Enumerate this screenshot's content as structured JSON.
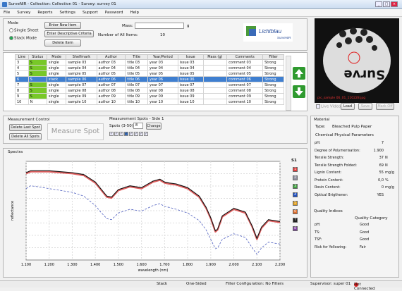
{
  "window": {
    "title": "SurveNIR - Collection: Collection 01 - Survey: survey 01"
  },
  "menu": [
    "File",
    "Survey",
    "Reports",
    "Settings",
    "Support",
    "Password",
    "Help"
  ],
  "mode": {
    "label": "Mode",
    "options": [
      "Single Sheet",
      "Stack Mode"
    ],
    "selected": "Stack Mode"
  },
  "buttons": {
    "enter_new": "Enter New Item",
    "enter_desc": "Enter Descriptive Criteria",
    "delete_item": "Delete Item",
    "delete_last": "Delete Last Spot",
    "delete_all": "Delete All Spots",
    "measure": "Measure Spot",
    "change": "Change",
    "live": "Live Video",
    "load": "Load",
    "save": "Save",
    "mark_off": "Mark Off"
  },
  "mass": {
    "label": "Mass:",
    "unit": "g",
    "items_label": "Number of All Items:",
    "items_value": "10"
  },
  "logo": {
    "text": "Lichtblau",
    "sub": "SurveNIR"
  },
  "camera": {
    "overlay": "Surve",
    "caption": "pic_sample 06_01_110228.jpg"
  },
  "table": {
    "columns": [
      "Line",
      "Status",
      "Mode",
      "Shelfmark",
      "Author",
      "Title",
      "Year/Period",
      "Issue",
      "Mass (g)",
      "Comments",
      "Filter"
    ],
    "rows": [
      [
        "3",
        "S",
        "single",
        "sample 03",
        "author 03",
        "title 03",
        "year 03",
        "issue 03",
        "",
        "comment 03",
        "Strong"
      ],
      [
        "4",
        "S",
        "single",
        "sample 04",
        "author 04",
        "title 04",
        "year 04",
        "issue 04",
        "",
        "comment 04",
        "Strong"
      ],
      [
        "5",
        "S",
        "single",
        "sample 05",
        "author 05",
        "title 05",
        "year 05",
        "issue 05",
        "",
        "comment 05",
        "Strong"
      ],
      [
        "6",
        "S",
        "stack",
        "sample 06",
        "author 06",
        "title 06",
        "year 06",
        "issue 06",
        "",
        "comment 06",
        "Strong"
      ],
      [
        "7",
        "S",
        "single",
        "sample 07",
        "author 07",
        "title 07",
        "year 07",
        "issue 07",
        "",
        "comment 07",
        "Strong"
      ],
      [
        "8",
        "S",
        "single",
        "sample 08",
        "author 08",
        "title 08",
        "year 08",
        "issue 08",
        "",
        "comment 08",
        "Strong"
      ],
      [
        "9",
        "S",
        "single",
        "sample 09",
        "author 09",
        "title 09",
        "year 09",
        "issue 09",
        "",
        "comment 09",
        "Strong"
      ],
      [
        "10",
        "N",
        "single",
        "sample 10",
        "author 10",
        "title 10",
        "year 10",
        "issue 10",
        "",
        "comment 10",
        "Strong"
      ]
    ],
    "selected_row": 3
  },
  "measure": {
    "control_label": "Measurement Control",
    "spots_label": "Measurement Spots - Side 1",
    "spots_count_label": "Spots (3-50):",
    "spots_count": "8"
  },
  "spectra": {
    "label": "Spectra",
    "side": "S1",
    "swatches": [
      "1",
      "2",
      "3",
      "4",
      "5",
      "6",
      "7",
      "8"
    ],
    "swatch_colors": [
      "#e04040",
      "#9090a0",
      "#40a040",
      "#2050c0",
      "#e0a020",
      "#e07030",
      "#202020",
      "#8040a0"
    ]
  },
  "material": {
    "label": "Material",
    "type_label": "Type:",
    "type_value": "Bleached Pulp Paper",
    "chem_label": "Chemical Physical Parameters",
    "params": [
      [
        "pH:",
        "7",
        ""
      ],
      [
        "Degree of Polymerisation:",
        "1.900",
        ""
      ],
      [
        "Tensile Strength:",
        "37",
        "N"
      ],
      [
        "Tensile Strength Folded:",
        "69",
        "N"
      ],
      [
        "Lignin Content:",
        "55",
        "mg/g"
      ],
      [
        "Protein Content:",
        "0,0",
        "%"
      ],
      [
        "Rosin Content:",
        "0",
        "mg/g"
      ],
      [
        "Optical Brigthener:",
        "YES",
        ""
      ]
    ],
    "quality_label": "Quality Indices",
    "quality_cat": "Quality Category",
    "quality": [
      [
        "pH:",
        "Good"
      ],
      [
        "TS:",
        "Good"
      ],
      [
        "TSF:",
        "Good"
      ],
      [
        "Risk for Yellowing:",
        "Fair"
      ]
    ]
  },
  "status": {
    "stack": "Stack",
    "sided": "One-Sided",
    "filter": "Filter Configuration: No Filters",
    "supervisor": "Supervisor: super 01",
    "conn": "Not Connected"
  },
  "chart_data": {
    "type": "line",
    "xlabel": "wavelength (nm)",
    "ylabel": "reflectance",
    "xlim": [
      1100,
      2200
    ],
    "x_ticks": [
      "1.100",
      "1.200",
      "1.300",
      "1.400",
      "1.500",
      "1.600",
      "1.700",
      "1.800",
      "1.900",
      "2.000",
      "2.100",
      "2.200"
    ],
    "x": [
      1100,
      1120,
      1150,
      1200,
      1250,
      1300,
      1350,
      1400,
      1420,
      1450,
      1470,
      1500,
      1550,
      1600,
      1650,
      1680,
      1700,
      1720,
      1750,
      1800,
      1850,
      1880,
      1900,
      1920,
      1930,
      1950,
      2000,
      2050,
      2080,
      2100,
      2120,
      2150,
      2200
    ],
    "series": [
      {
        "values": [
          0.82,
          0.84,
          0.84,
          0.84,
          0.83,
          0.82,
          0.8,
          0.72,
          0.66,
          0.57,
          0.56,
          0.64,
          0.68,
          0.66,
          0.73,
          0.75,
          0.72,
          0.71,
          0.7,
          0.66,
          0.57,
          0.45,
          0.34,
          0.2,
          0.22,
          0.36,
          0.44,
          0.4,
          0.25,
          0.12,
          0.24,
          0.32,
          0.3
        ]
      },
      {
        "values": [
          0.83,
          0.85,
          0.85,
          0.85,
          0.84,
          0.83,
          0.81,
          0.73,
          0.67,
          0.58,
          0.57,
          0.65,
          0.69,
          0.67,
          0.74,
          0.76,
          0.73,
          0.72,
          0.71,
          0.67,
          0.58,
          0.46,
          0.35,
          0.21,
          0.23,
          0.37,
          0.45,
          0.41,
          0.26,
          0.13,
          0.25,
          0.33,
          0.31
        ]
      },
      {
        "values": [
          0.66,
          0.69,
          0.68,
          0.66,
          0.64,
          0.62,
          0.58,
          0.48,
          0.42,
          0.34,
          0.33,
          0.4,
          0.44,
          0.42,
          0.48,
          0.5,
          0.47,
          0.46,
          0.44,
          0.4,
          0.32,
          0.22,
          0.12,
          0.02,
          0.03,
          0.12,
          0.18,
          0.14,
          0.03,
          -0.04,
          0.03,
          0.09,
          0.07
        ]
      }
    ]
  }
}
